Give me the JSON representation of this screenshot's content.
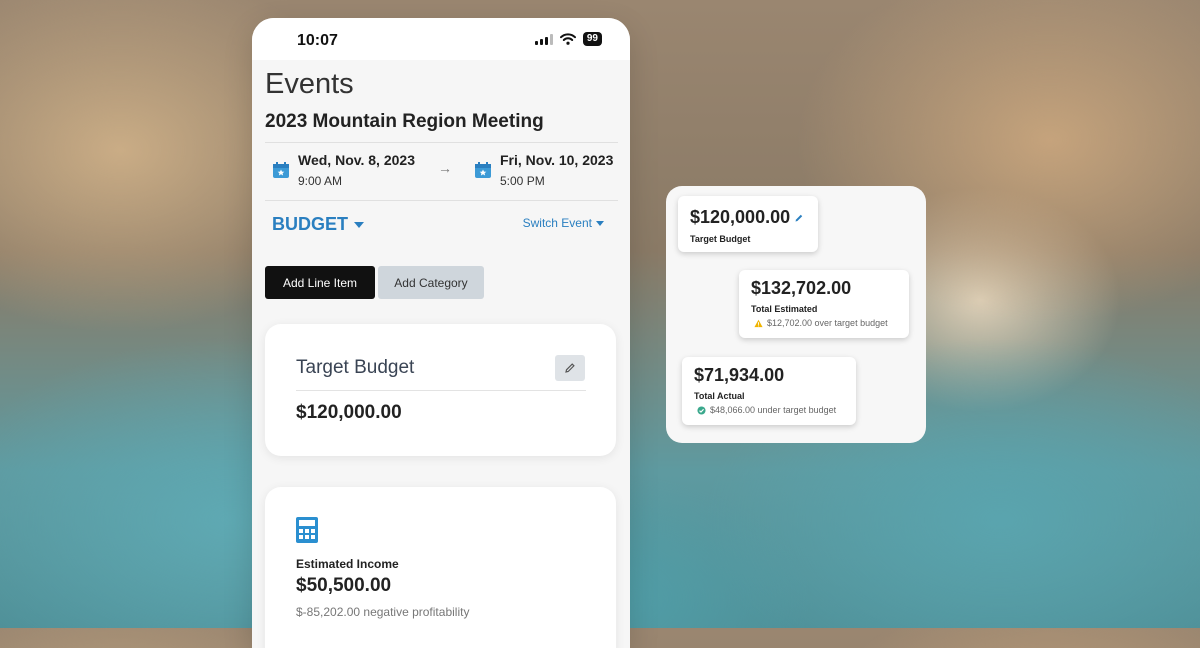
{
  "status_bar": {
    "time": "10:07",
    "battery": "99"
  },
  "page": {
    "title": "Events",
    "event_name": "2023 Mountain Region Meeting",
    "start": {
      "date": "Wed, Nov. 8, 2023",
      "time": "9:00 AM"
    },
    "end": {
      "date": "Fri, Nov. 10, 2023",
      "time": "5:00 PM"
    },
    "arrow": "→",
    "section_tab": "BUDGET",
    "switch_event": "Switch Event",
    "buttons": {
      "add_line_item": "Add Line Item",
      "add_category": "Add Category"
    },
    "target_budget_card": {
      "title": "Target Budget",
      "amount": "$120,000.00"
    },
    "estimated_income_card": {
      "label": "Estimated Income",
      "amount": "$50,500.00",
      "note": "$-85,202.00 negative profitability"
    }
  },
  "summary_panel": {
    "target": {
      "amount": "$120,000.00",
      "label": "Target Budget"
    },
    "estimated": {
      "amount": "$132,702.00",
      "label": "Total Estimated",
      "note": "$12,702.00 over target budget"
    },
    "actual": {
      "amount": "$71,934.00",
      "label": "Total Actual",
      "note": "$48,066.00 under target budget"
    }
  },
  "colors": {
    "accent": "#2a7fc0",
    "warning": "#f0b400",
    "success": "#3aa88c"
  }
}
